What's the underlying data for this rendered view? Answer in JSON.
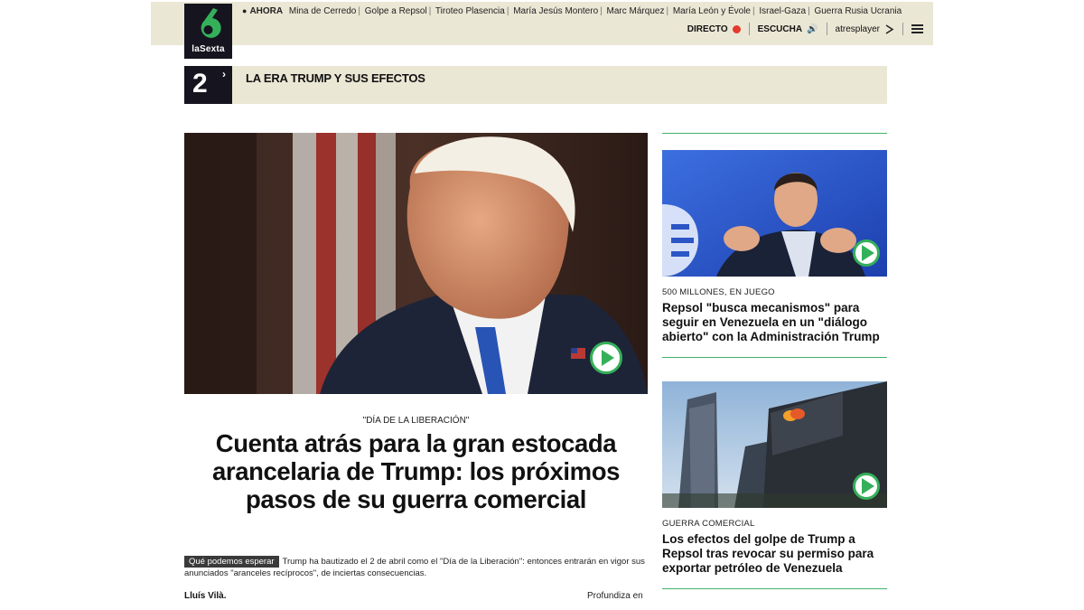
{
  "brand": {
    "name": "laSexta",
    "logo_icon": "lasexta-six-icon",
    "accent": "#35b05a"
  },
  "topbar": {
    "now_label": "AHORA",
    "links": [
      "Mina de Cerredo",
      "Golpe a Repsol",
      "Tiroteo Plasencia",
      "María Jesús Montero",
      "Marc Márquez",
      "María León y Évole",
      "Israel-Gaza",
      "Guerra Rusia Ucrania"
    ],
    "live_label": "DIRECTO",
    "listen_label": "ESCUCHA",
    "atres_label": "atresplayer",
    "colors": {
      "bar": "#ebe7d5",
      "live_dot": "#e53a2b"
    }
  },
  "section": {
    "number": "2",
    "title": "LA ERA TRUMP Y SUS EFECTOS"
  },
  "main": {
    "kicker": "\"DÍA DE LA LIBERACIÓN\"",
    "headline": "Cuenta atrás para la gran estocada arancelaria de Trump: los próximos pasos de su guerra comercial",
    "tag": "Qué podemos esperar",
    "lede": "Trump ha bautizado el 2 de abril como el \"Día de la Liberación\": entonces entrarán en vigor sus anunciados \"aranceles recíprocos\", de inciertas consecuencias.",
    "byline": "Lluís Vilà.",
    "deeper": "Profundiza en"
  },
  "sidebar": [
    {
      "kicker": "500 MILLONES, EN JUEGO",
      "title": "Repsol \"busca mecanismos\" para seguir en Venezuela en un \"diálogo abierto\" con la Administración Trump"
    },
    {
      "kicker": "GUERRA COMERCIAL",
      "title": "Los efectos del golpe de Trump a Repsol tras revocar su permiso para exportar petróleo de Venezuela"
    }
  ]
}
